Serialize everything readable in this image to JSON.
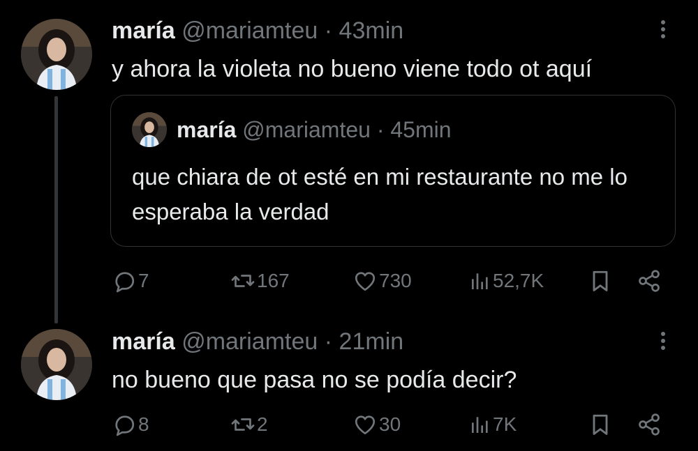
{
  "colors": {
    "background": "#000000",
    "text_primary": "#e7e9ea",
    "text_secondary": "#71767b",
    "border": "#2f3336",
    "thread_line": "#333639"
  },
  "icons": {
    "reply": "speech-bubble-icon",
    "repost": "repost-arrows-icon",
    "like": "heart-icon",
    "views": "bar-chart-icon",
    "bookmark": "bookmark-icon",
    "share": "share-nodes-icon",
    "more": "vertical-ellipsis-icon"
  },
  "tweets": [
    {
      "author_name": "maría",
      "handle": "@mariamteu",
      "separator": "·",
      "time": "43min",
      "text": "y ahora la violeta no bueno viene todo ot aquí",
      "quote": {
        "author_name": "maría",
        "handle": "@mariamteu",
        "separator": "·",
        "time": "45min",
        "text": "que chiara de ot esté en mi restaurante no me lo esperaba la verdad"
      },
      "stats": {
        "replies": "7",
        "reposts": "167",
        "likes": "730",
        "views": "52,7K"
      }
    },
    {
      "author_name": "maría",
      "handle": "@mariamteu",
      "separator": "·",
      "time": "21min",
      "text": "no bueno que pasa no se podía decir?",
      "stats": {
        "replies": "8",
        "reposts": "2",
        "likes": "30",
        "views": "7K"
      }
    }
  ]
}
